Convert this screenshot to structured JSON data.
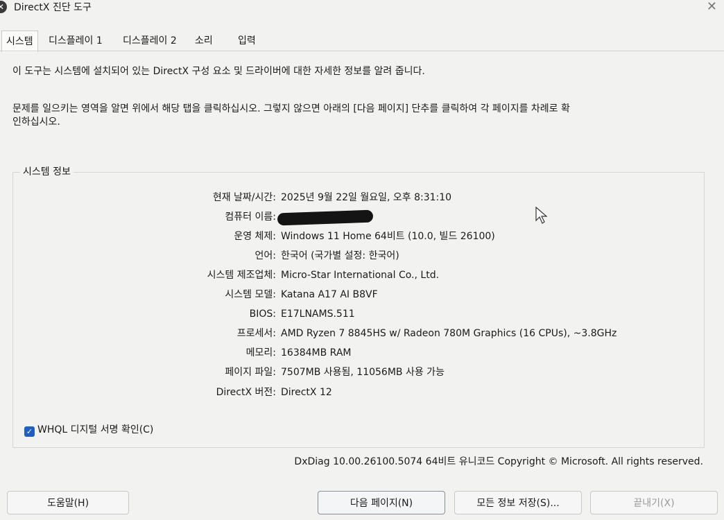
{
  "window": {
    "title": "DirectX 진단 도구",
    "close_glyph": "✕"
  },
  "tabs": [
    {
      "label": "시스템",
      "active": true
    },
    {
      "label": "디스플레이 1",
      "active": false
    },
    {
      "label": "디스플레이 2",
      "active": false
    },
    {
      "label": "소리",
      "active": false
    },
    {
      "label": "입력",
      "active": false
    }
  ],
  "intro": "이 도구는 시스템에 설치되어 있는 DirectX 구성 요소 및 드라이버에 대한 자세한 정보를 알려 줍니다.",
  "help_line1": "문제를 일으키는 영역을 알면 위에서 해당 탭을 클릭하십시오. 그렇지 않으면 아래의 [다음 페이지] 단추를 클릭하여 각 페이지를 차례로 확",
  "help_line2": "인하십시오.",
  "system_info": {
    "group_title": "시스템 정보",
    "rows": [
      {
        "label": "현재 날짜/시간:",
        "value": "2025년 9월 22일 월요일, 오후 8:31:10"
      },
      {
        "label": "컴퓨터 이름:",
        "value": ""
      },
      {
        "label": "운영 체제:",
        "value": "Windows 11 Home 64비트 (10.0, 빌드 26100)"
      },
      {
        "label": "언어:",
        "value": "한국어 (국가별 설정: 한국어)"
      },
      {
        "label": "시스템 제조업체:",
        "value": "Micro-Star International Co., Ltd."
      },
      {
        "label": "시스템 모델:",
        "value": "Katana A17 AI B8VF"
      },
      {
        "label": "BIOS:",
        "value": "E17LNAMS.511"
      },
      {
        "label": "프로세서:",
        "value": "AMD Ryzen 7 8845HS w/ Radeon 780M Graphics (16 CPUs), ~3.8GHz"
      },
      {
        "label": "메모리:",
        "value": "16384MB RAM"
      },
      {
        "label": "페이지 파일:",
        "value": "7507MB 사용됨, 11056MB 사용 가능"
      },
      {
        "label": "DirectX 버전:",
        "value": "DirectX 12"
      }
    ]
  },
  "whql": {
    "label": "WHQL 디지털 서명 확인(C)",
    "checked": true
  },
  "footer": "DxDiag 10.00.26100.5074 64비트 유니코드  Copyright © Microsoft. All rights reserved.",
  "buttons": {
    "help": "도움말(H)",
    "next": "다음 페이지(N)",
    "save": "모든 정보 저장(S)...",
    "exit": "끝내기(X)"
  },
  "colors": {
    "accent": "#1f5fbf"
  }
}
